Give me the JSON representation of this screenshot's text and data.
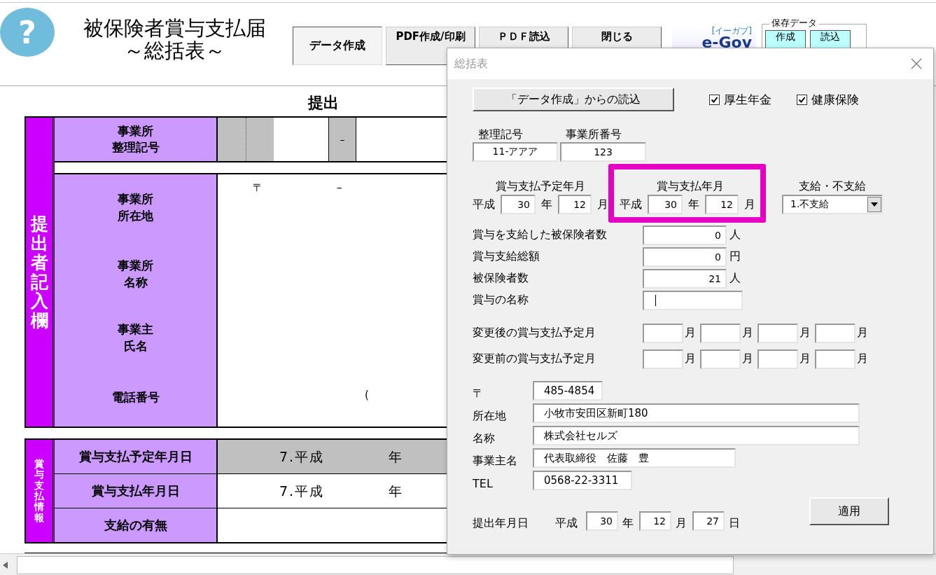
{
  "header": {
    "help": "?",
    "title_lines": [
      "被保険者賞与支払届",
      "～総括表～"
    ],
    "buttons": [
      {
        "label": "データ作成",
        "selected": true
      },
      {
        "label": "PDF作成/印刷",
        "selected": false
      },
      {
        "label": "ＰＤＦ読込",
        "selected": false
      },
      {
        "label": "閉じる",
        "selected": false
      }
    ],
    "logo": {
      "text": "e-Gov",
      "tag": "[イーガブ]"
    },
    "saved_data": {
      "legend": "保存データ",
      "buttons": [
        "作成",
        "読込"
      ]
    }
  },
  "sheet": {
    "heading": "提出",
    "filer": {
      "side_label": "提出者記入欄",
      "code_label": [
        "事業所",
        "整理記号"
      ],
      "code_dash": "–",
      "rows": [
        {
          "kind": "address",
          "label": [
            "事業所",
            "所在地"
          ],
          "marks": [
            "〒",
            "–"
          ]
        },
        {
          "kind": "plain",
          "label": [
            "事業所",
            "名称"
          ]
        },
        {
          "kind": "plain",
          "label": [
            "事業主",
            "氏名"
          ]
        },
        {
          "kind": "phone",
          "label": [
            "電話番号"
          ],
          "marks": [
            "("
          ]
        }
      ]
    },
    "bonus": {
      "side_label": "賞与支払情報",
      "rows": [
        {
          "label": "賞与支払予定年月日",
          "shaded": true,
          "era": "7.平成",
          "year": "年"
        },
        {
          "label": "賞与支払年月日",
          "shaded": false,
          "era": "7.平成",
          "year": "年"
        },
        {
          "label": "支給の有無",
          "shaded": false
        }
      ]
    }
  },
  "dialog": {
    "title": "総括表",
    "load_button": "「データ作成」からの読込",
    "checkboxes": [
      {
        "label": "厚生年金",
        "checked": true
      },
      {
        "label": "健康保険",
        "checked": true
      }
    ],
    "office": [
      {
        "label": "整理記号",
        "value": "11-アアア"
      },
      {
        "label": "事業所番号",
        "value": "123"
      }
    ],
    "periods": [
      {
        "label": "賞与支払予定年月",
        "era": "平成",
        "year": "30",
        "year_unit": "年",
        "month": "12",
        "month_unit": "月",
        "highlighted": false
      },
      {
        "label": "賞与支払年月",
        "era": "平成",
        "year": "30",
        "year_unit": "年",
        "month": "12",
        "month_unit": "月",
        "highlighted": true
      }
    ],
    "payment": {
      "label": "支給・不支給",
      "value": "1.不支給"
    },
    "counts": [
      {
        "kind": "number",
        "label": "賞与を支給した被保険者数",
        "value": "0",
        "unit": "人"
      },
      {
        "kind": "number",
        "label": "賞与支給総額",
        "value": "0",
        "unit": "円"
      },
      {
        "kind": "number",
        "label": "被保険者数",
        "value": "21",
        "unit": "人"
      },
      {
        "kind": "text",
        "label": "賞与の名称",
        "focused": true
      }
    ],
    "month_rows": [
      {
        "label": "変更後の賞与支払予定月",
        "units": [
          "月",
          "月",
          "月",
          "月"
        ]
      },
      {
        "label": "変更前の賞与支払予定月",
        "units": [
          "月",
          "月",
          "月",
          "月"
        ]
      }
    ],
    "address": [
      {
        "label": "〒",
        "value": "485-4854"
      },
      {
        "label": "所在地",
        "value": "小牧市安田区新町180"
      },
      {
        "label": "名称",
        "value": "株式会社セルズ"
      },
      {
        "label": "事業主名",
        "value": "代表取締役　佐藤　豊"
      },
      {
        "label": "TEL",
        "value": "0568-22-3311"
      }
    ],
    "submit": {
      "label": "提出年月日",
      "era": "平成",
      "parts": [
        {
          "value": "30",
          "unit": "年"
        },
        {
          "value": "12",
          "unit": "月"
        },
        {
          "value": "27",
          "unit": "日"
        }
      ]
    },
    "apply_button": "適用"
  }
}
